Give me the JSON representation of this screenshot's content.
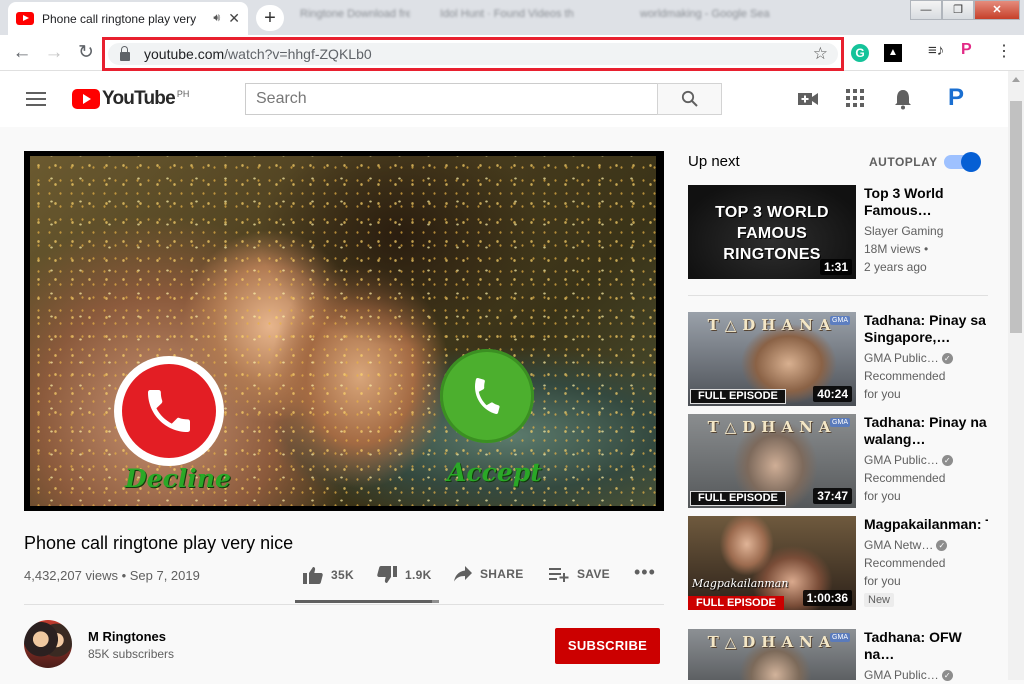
{
  "browser": {
    "tab_title": "Phone call ringtone play very",
    "bg_tabs": [
      "Ringtone Download fre",
      "Idol Hunt · Found Videos th",
      "worldmaking - Google Sea"
    ],
    "url_domain": "youtube.com",
    "url_path": "/watch?v=hhgf-ZQKLb0"
  },
  "yt_header": {
    "logo_text": "YouTube",
    "country": "PH",
    "search_placeholder": "Search"
  },
  "video": {
    "title": "Phone call ringtone play very nice",
    "meta": "4,432,207 views • Sep 7, 2019",
    "decline_label": "Decline",
    "accept_label": "Accept",
    "likes": "35K",
    "dislikes": "1.9K",
    "like_ratio": 0.95,
    "share_label": "SHARE",
    "save_label": "SAVE"
  },
  "channel": {
    "name": "M Ringtones",
    "subscribers": "85K subscribers",
    "subscribe_label": "SUBSCRIBE"
  },
  "sidebar": {
    "up_next": "Up next",
    "autoplay": "AUTOPLAY",
    "autoplay_on": true,
    "first": {
      "thumb_text": "TOP 3 WORLD FAMOUS RINGTONES",
      "duration": "1:31",
      "title": "Top 3 World Famous…",
      "channel": "Slayer Gaming",
      "views": "18M views •",
      "age": "2 years ago"
    },
    "items": [
      {
        "brand": "T△DHANA",
        "badge": "FULL EPISODE",
        "duration": "40:24",
        "title": "Tadhana: Pinay sa Singapore,…",
        "channel": "GMA Public…",
        "line2": "Recommended",
        "line3": "for you",
        "new": ""
      },
      {
        "brand": "T△DHANA",
        "badge": "FULL EPISODE",
        "duration": "37:47",
        "title": "Tadhana: Pinay na walang…",
        "channel": "GMA Public…",
        "line2": "Recommended",
        "line3": "for you",
        "new": ""
      },
      {
        "brand": "Magpakailanman",
        "badge": "FULL EPISODE",
        "duration": "1:00:36",
        "title": "Magpakailanman: Teenage girl…",
        "channel": "GMA Netw…",
        "line2": "Recommended",
        "line3": "for you",
        "new": "New"
      },
      {
        "brand": "T△DHANA",
        "badge": "",
        "duration": "",
        "title": "Tadhana: OFW na…",
        "channel": "GMA Public…",
        "line2": "",
        "line3": "",
        "new": ""
      }
    ]
  }
}
